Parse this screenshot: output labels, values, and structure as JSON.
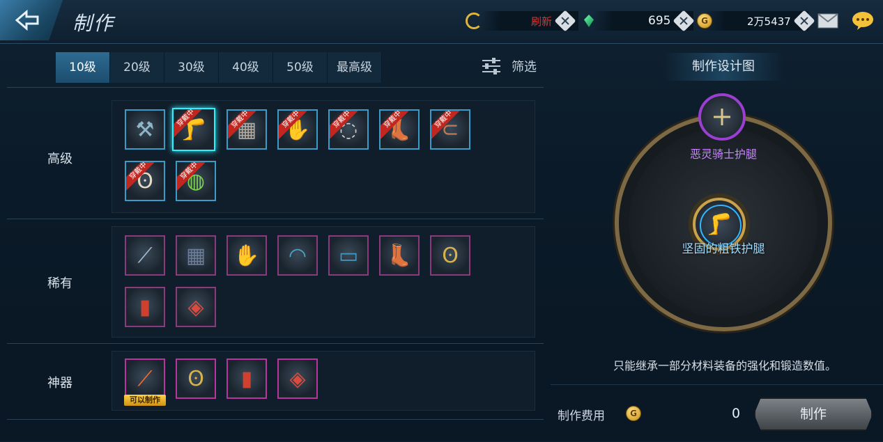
{
  "header": {
    "title": "制作",
    "refresh_label": "刷新",
    "gems": "695",
    "gold": "2万5437"
  },
  "tabs": [
    "10级",
    "20级",
    "30级",
    "40级",
    "50级",
    "最高级"
  ],
  "filter_label": "筛选",
  "sections": {
    "advanced": {
      "label": "高级",
      "tag": "穿戴中"
    },
    "rare": {
      "label": "稀有"
    },
    "artifact": {
      "label": "神器",
      "craftable_badge": "可以制作"
    }
  },
  "blueprint": {
    "title": "制作设计图",
    "result_name": "恶灵骑士护腿",
    "material_name": "坚固的粗铁护腿",
    "note": "只能继承一部分材料装备的强化和锻造数值。"
  },
  "cost": {
    "label": "制作费用",
    "value": "0",
    "button": "制作"
  },
  "colors": {
    "advanced_border": "#3b9bc9",
    "rare_border": "#8a3a7d",
    "artifact_border": "#b9359e",
    "selected_border": "#2ff0ff",
    "refresh_text": "#e0322b",
    "result_name_color": "#c884ff",
    "material_name_color": "#9fdcff"
  }
}
